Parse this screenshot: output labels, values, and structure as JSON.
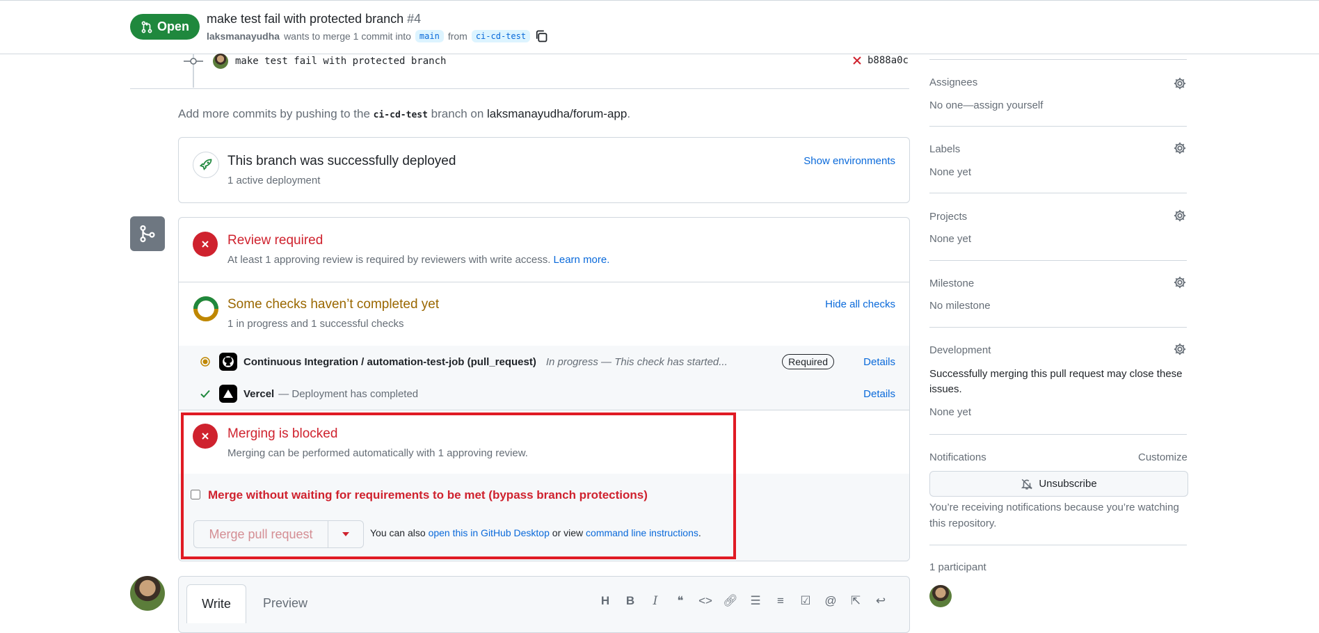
{
  "header": {
    "state": "Open",
    "title": "make test fail with protected branch",
    "number": "#4",
    "author": "laksmanayudha",
    "merge_text": "wants to merge 1 commit into",
    "base_branch": "main",
    "from_text": "from",
    "head_branch": "ci-cd-test"
  },
  "commit": {
    "message": "make test fail with protected branch",
    "sha": "b888a0c"
  },
  "add_commits": {
    "prefix": "Add more commits by pushing to the",
    "branch": "ci-cd-test",
    "middle": "branch on",
    "repo": "laksmanayudha/forum-app",
    "suffix": "."
  },
  "deployment": {
    "title": "This branch was successfully deployed",
    "subtitle": "1 active deployment",
    "link": "Show environments"
  },
  "review": {
    "title": "Review required",
    "subtitle": "At least 1 approving review is required by reviewers with write access.",
    "learn_more": "Learn more."
  },
  "checks": {
    "title": "Some checks haven’t completed yet",
    "subtitle": "1 in progress and 1 successful checks",
    "toggle": "Hide all checks",
    "items": [
      {
        "name": "Continuous Integration / automation-test-job (pull_request)",
        "status": "In progress — This check has started...",
        "badge": "Required",
        "details": "Details"
      },
      {
        "name": "Vercel",
        "status": "— Deployment has completed",
        "details": "Details"
      }
    ]
  },
  "merge": {
    "title": "Merging is blocked",
    "subtitle": "Merging can be performed automatically with 1 approving review.",
    "bypass_label": "Merge without waiting for requirements to be met (bypass branch protections)",
    "button": "Merge pull request",
    "also_text": "You can also",
    "desktop_link": "open this in GitHub Desktop",
    "or_view": "or view",
    "cli_link": "command line instructions",
    "period": "."
  },
  "comment": {
    "tab_write": "Write",
    "tab_preview": "Preview"
  },
  "sidebar": {
    "assignees": {
      "heading": "Assignees",
      "value": "No one—assign yourself"
    },
    "labels": {
      "heading": "Labels",
      "value": "None yet"
    },
    "projects": {
      "heading": "Projects",
      "value": "None yet"
    },
    "milestone": {
      "heading": "Milestone",
      "value": "No milestone"
    },
    "development": {
      "heading": "Development",
      "description": "Successfully merging this pull request may close these issues.",
      "value": "None yet"
    },
    "notifications": {
      "heading": "Notifications",
      "customize": "Customize",
      "button": "Unsubscribe",
      "note": "You’re receiving notifications because you’re watching this repository."
    },
    "participants": {
      "heading": "1 participant"
    }
  },
  "colors": {
    "open_green": "#1f883d",
    "danger": "#cf222e",
    "warning_text": "#9a6700",
    "link": "#0969da",
    "outline": "#e01b24"
  }
}
